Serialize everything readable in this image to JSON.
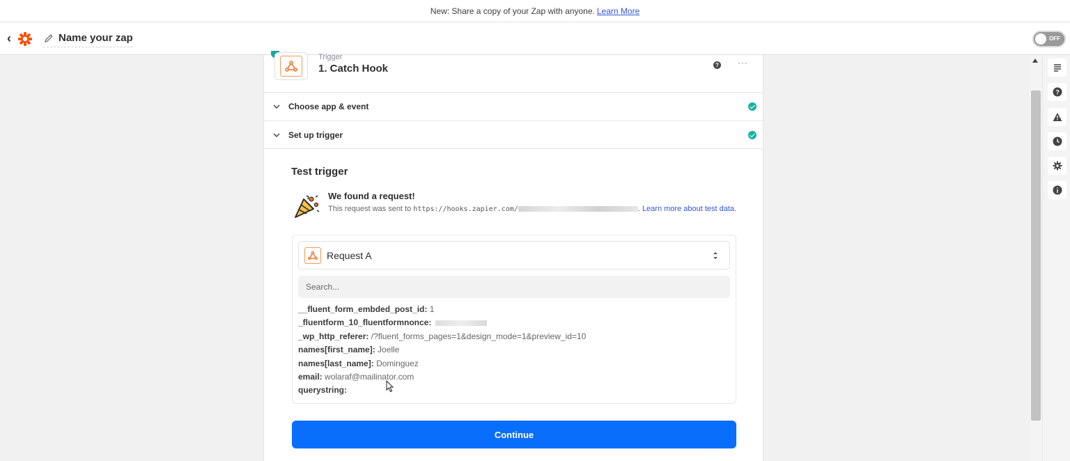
{
  "banner": {
    "text": "New: Share a copy of your Zap with anyone.",
    "link": "Learn More"
  },
  "header": {
    "zap_name": "Name your zap",
    "toggle_label": "OFF"
  },
  "step": {
    "type": "Trigger",
    "title": "1. Catch Hook",
    "more": "···"
  },
  "sections": [
    {
      "label": "Choose app & event"
    },
    {
      "label": "Set up trigger"
    }
  ],
  "test": {
    "title": "Test trigger",
    "found_title": "We found a request!",
    "desc_prefix": "This request was sent to",
    "desc_url": "https://hooks.zapier.com/",
    "desc_link": "Learn more about test data."
  },
  "request": {
    "selected": "Request A",
    "search_placeholder": "Search..."
  },
  "fields": [
    {
      "key": "__fluent_form_embded_post_id:",
      "value": "1"
    },
    {
      "key": "_fluentform_10_fluentformnonce:",
      "value": ""
    },
    {
      "key": "_wp_http_referer:",
      "value": "/?fluent_forms_pages=1&design_mode=1&preview_id=10"
    },
    {
      "key": "names[first_name]:",
      "value": "Joelle"
    },
    {
      "key": "names[last_name]:",
      "value": "Dominguez"
    },
    {
      "key": "email:",
      "value": "wolaraf@mailinator.com"
    },
    {
      "key": "querystring:",
      "value": ""
    }
  ],
  "continue_label": "Continue",
  "colors": {
    "primary": "#0a6efd",
    "check": "#17b3a3",
    "brand": "#ff4f00",
    "link": "#3455db"
  }
}
